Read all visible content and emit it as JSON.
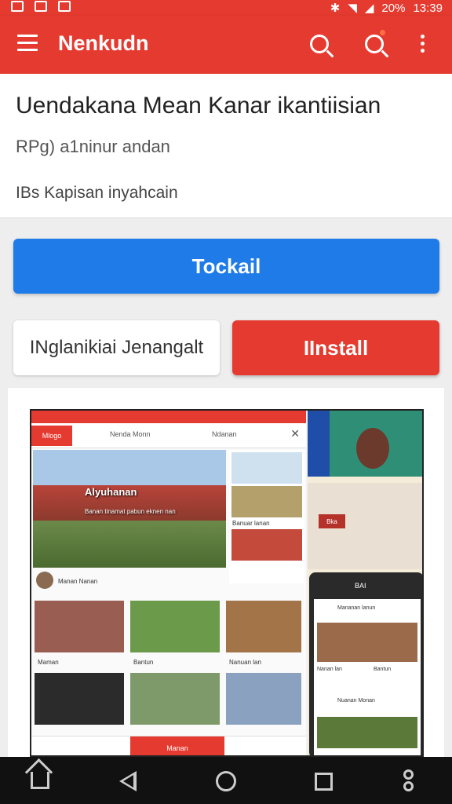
{
  "status": {
    "battery": "20%",
    "time": "13:39"
  },
  "appbar": {
    "title": "Nenkudn"
  },
  "app_info": {
    "title": "Uendakana Mean Kanar ikantiisian",
    "subtitle": "RPg) a1ninur andan",
    "meta": "IBs Kapisan inyahcain"
  },
  "actions": {
    "primary": "Tockail",
    "secondary": "INglanikiai Jenangalt",
    "install": "IInstall"
  },
  "screenshot": {
    "logo": "Mlogo",
    "search_a": "Nenda Monn",
    "search_b": "Ndanan",
    "hero_title": "Alyuhanan",
    "hero_sub": "Banan tinamat pabun eknen nan",
    "side_caption": "Banuar lanan",
    "author": "Manan Nanan",
    "tile_captions": [
      "Maman",
      "Bantun",
      "Nanuan lan"
    ],
    "bottom_tab": "Manan",
    "chip": "Bka",
    "card_title": "BAI",
    "inner_title": "Mananan lanun",
    "inner_caption_a": "Nanan lan",
    "inner_caption_b": "Bantun",
    "inner_footer": "Nuanan Monan"
  }
}
